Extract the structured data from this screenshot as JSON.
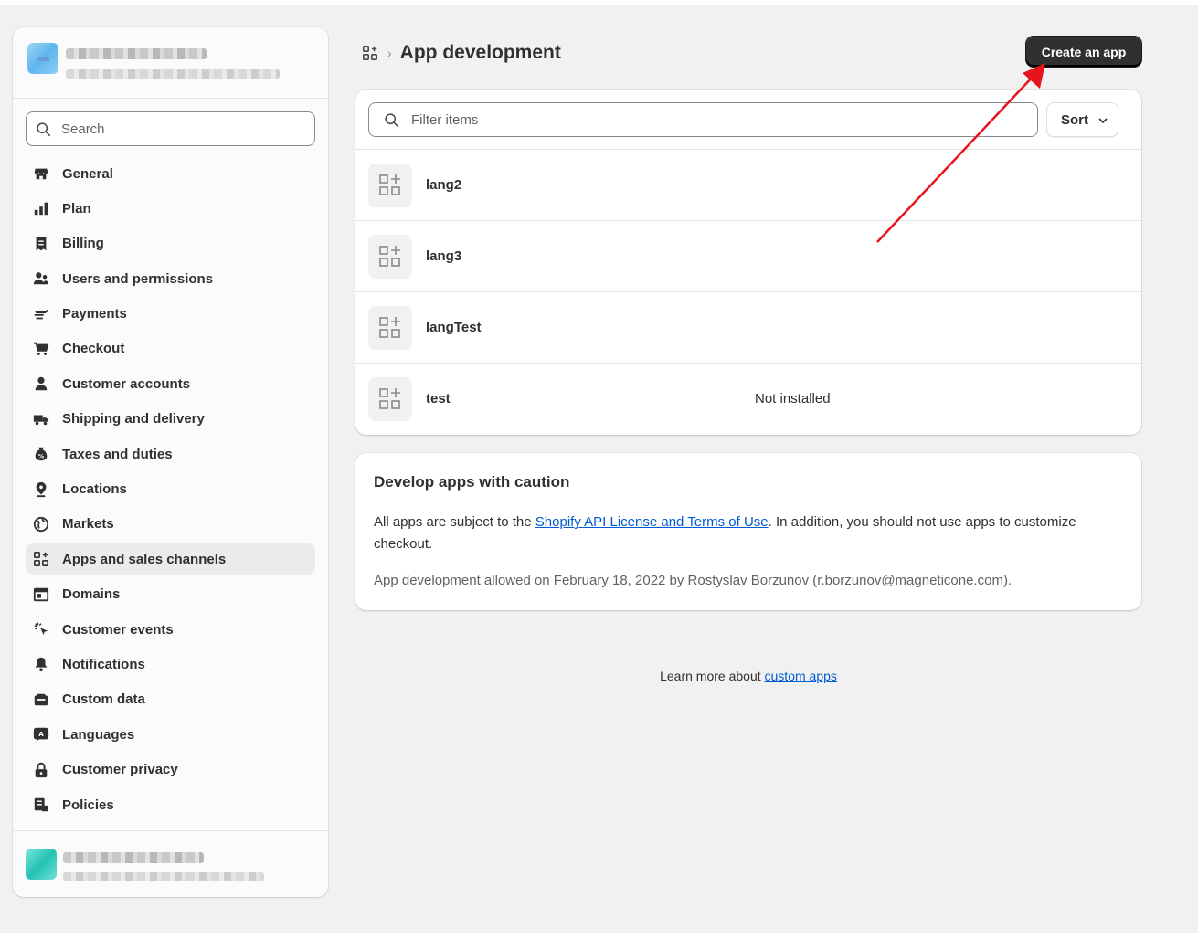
{
  "sidebar": {
    "search_placeholder": "Search",
    "items": [
      {
        "label": "General",
        "icon": "store-icon"
      },
      {
        "label": "Plan",
        "icon": "plan-icon"
      },
      {
        "label": "Billing",
        "icon": "billing-icon"
      },
      {
        "label": "Users and permissions",
        "icon": "users-icon"
      },
      {
        "label": "Payments",
        "icon": "payments-icon"
      },
      {
        "label": "Checkout",
        "icon": "cart-icon"
      },
      {
        "label": "Customer accounts",
        "icon": "person-icon"
      },
      {
        "label": "Shipping and delivery",
        "icon": "truck-icon"
      },
      {
        "label": "Taxes and duties",
        "icon": "tax-icon"
      },
      {
        "label": "Locations",
        "icon": "location-icon"
      },
      {
        "label": "Markets",
        "icon": "globe-icon"
      },
      {
        "label": "Apps and sales channels",
        "icon": "apps-icon",
        "active": true
      },
      {
        "label": "Domains",
        "icon": "domains-icon"
      },
      {
        "label": "Customer events",
        "icon": "cursor-icon"
      },
      {
        "label": "Notifications",
        "icon": "bell-icon"
      },
      {
        "label": "Custom data",
        "icon": "custom-data-icon"
      },
      {
        "label": "Languages",
        "icon": "language-icon"
      },
      {
        "label": "Customer privacy",
        "icon": "lock-icon"
      },
      {
        "label": "Policies",
        "icon": "policies-icon"
      }
    ]
  },
  "header": {
    "title": "App development",
    "create_button": "Create an app"
  },
  "app_list": {
    "filter_placeholder": "Filter items",
    "sort_label": "Sort",
    "apps": [
      {
        "name": "lang2",
        "status": ""
      },
      {
        "name": "lang3",
        "status": ""
      },
      {
        "name": "langTest",
        "status": ""
      },
      {
        "name": "test",
        "status": "Not installed"
      }
    ]
  },
  "caution": {
    "title": "Develop apps with caution",
    "text_before": "All apps are subject to the ",
    "link_text": "Shopify API License and Terms of Use",
    "text_after": ". In addition, you should not use apps to customize checkout.",
    "meta": "App development allowed on February 18, 2022 by Rostyslav Borzunov (r.borzunov@magneticone.com)."
  },
  "footer": {
    "learn_more_text": "Learn more about ",
    "learn_more_link": "custom apps"
  },
  "colors": {
    "accent_link": "#005bd3",
    "primary_button": "#303030",
    "annotation_arrow": "#e8141b"
  }
}
